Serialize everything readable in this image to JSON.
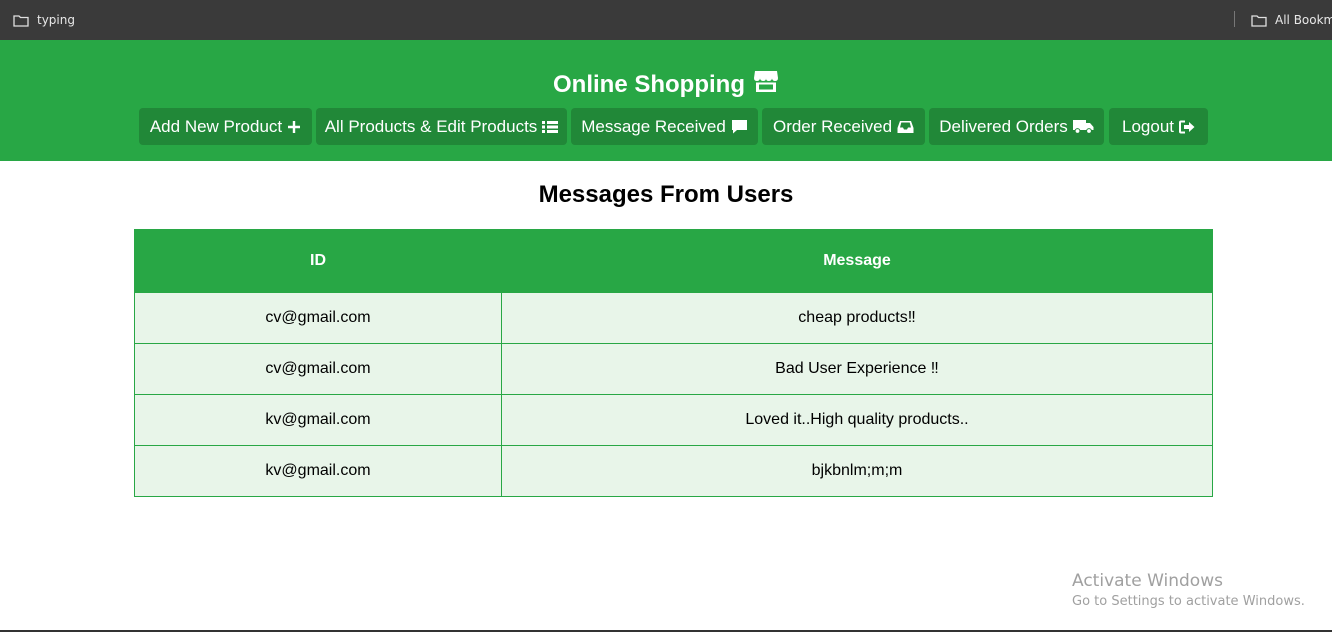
{
  "bookmarks": {
    "left_label": "typing",
    "right_label": "All Bookma",
    "folder_icon": "folder-icon"
  },
  "header": {
    "title": "Online Shopping",
    "title_icon": "store-icon",
    "nav": [
      {
        "label": "Add New Product",
        "icon": "plus-icon"
      },
      {
        "label": "All Products & Edit Products",
        "icon": "list-icon"
      },
      {
        "label": "Message Received",
        "icon": "comment-icon"
      },
      {
        "label": "Order Received",
        "icon": "inbox-icon"
      },
      {
        "label": "Delivered Orders",
        "icon": "truck-icon"
      },
      {
        "label": "Logout",
        "icon": "sign-out-icon"
      }
    ]
  },
  "main": {
    "title": "Messages From Users",
    "columns": [
      "ID",
      "Message"
    ],
    "rows": [
      {
        "id": "cv@gmail.com",
        "message": "cheap products‼"
      },
      {
        "id": "cv@gmail.com",
        "message": "Bad User Experience ‼"
      },
      {
        "id": "kv@gmail.com",
        "message": "Loved it..High quality products.."
      },
      {
        "id": "kv@gmail.com",
        "message": "bjkbnlm;m;m"
      }
    ]
  },
  "watermark": {
    "line1": "Activate Windows",
    "line2": "Go to Settings to activate Windows."
  },
  "colors": {
    "header_green": "#28a745",
    "button_green": "#218838",
    "row_bg": "#e8f5e9"
  }
}
